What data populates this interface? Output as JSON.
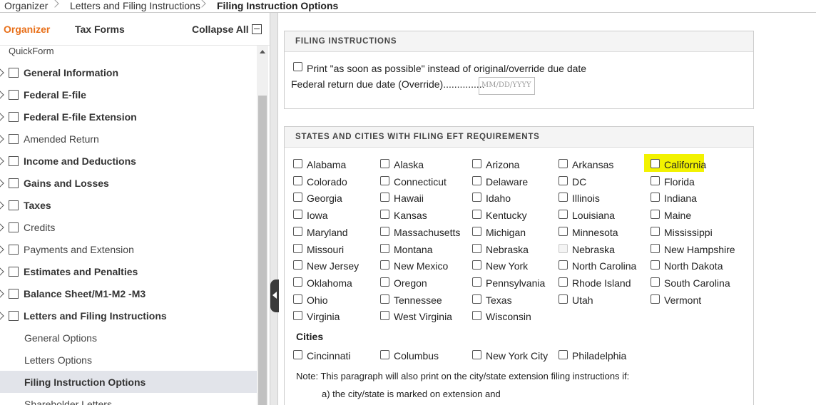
{
  "breadcrumb": [
    "Organizer",
    "Letters and Filing Instructions",
    "Filing Instruction Options"
  ],
  "tabs": {
    "organizer": "Organizer",
    "tax_forms": "Tax Forms",
    "collapse_all": "Collapse All"
  },
  "tree": {
    "quickform": "QuickForm",
    "items": [
      {
        "label": "General Information",
        "bold": true
      },
      {
        "label": "Federal E-file",
        "bold": true
      },
      {
        "label": "Federal E-file Extension",
        "bold": true
      },
      {
        "label": "Amended Return",
        "bold": false
      },
      {
        "label": "Income and Deductions",
        "bold": true
      },
      {
        "label": "Gains and Losses",
        "bold": true
      },
      {
        "label": "Taxes",
        "bold": true
      },
      {
        "label": "Credits",
        "bold": false
      },
      {
        "label": "Payments and Extension",
        "bold": false
      },
      {
        "label": "Estimates and Penalties",
        "bold": true
      },
      {
        "label": "Balance Sheet/M1-M2 -M3",
        "bold": true
      },
      {
        "label": "Letters and Filing Instructions",
        "bold": true
      }
    ],
    "children": [
      {
        "label": "General Options",
        "selected": false
      },
      {
        "label": "Letters Options",
        "selected": false
      },
      {
        "label": "Filing Instruction Options",
        "selected": true
      },
      {
        "label": "Shareholder Letters",
        "selected": false
      }
    ]
  },
  "filing": {
    "header": "FILING INSTRUCTIONS",
    "asap_label": "Print \"as soon as possible\" instead of original/override due date",
    "due_date_label": "Federal return due date (Override)...............",
    "due_date_placeholder": "MM/DD/YYYY"
  },
  "states": {
    "header": "STATES AND CITIES WITH FILING EFT REQUIREMENTS",
    "highlight_color": "#f2f200",
    "rows": [
      [
        "Alabama",
        "Alaska",
        "Arizona",
        "Arkansas",
        "California"
      ],
      [
        "Colorado",
        "Connecticut",
        "Delaware",
        "DC",
        "Florida"
      ],
      [
        "Georgia",
        "Hawaii",
        "Idaho",
        "Illinois",
        "Indiana"
      ],
      [
        "Iowa",
        "Kansas",
        "Kentucky",
        "Louisiana",
        "Maine"
      ],
      [
        "Maryland",
        "Massachusetts",
        "Michigan",
        "Minnesota",
        "Mississippi"
      ],
      [
        "Missouri",
        "Montana",
        "Nebraska",
        "Nebraska",
        "New Hampshire"
      ],
      [
        "New Jersey",
        "New Mexico",
        "New York",
        "North Carolina",
        "North Dakota"
      ],
      [
        "Oklahoma",
        "Oregon",
        "Pennsylvania",
        "Rhode Island",
        "South Carolina"
      ],
      [
        "Ohio",
        "Tennessee",
        "Texas",
        "Utah",
        "Vermont"
      ],
      [
        "Virginia",
        "West Virginia",
        "Wisconsin"
      ]
    ],
    "cities_label": "Cities",
    "cities": [
      "Cincinnati",
      "Columbus",
      "New York City",
      "Philadelphia"
    ],
    "note": "Note: This paragraph will also print on the city/state extension filing instructions if:",
    "note_a": "a) the city/state is marked on extension and"
  }
}
